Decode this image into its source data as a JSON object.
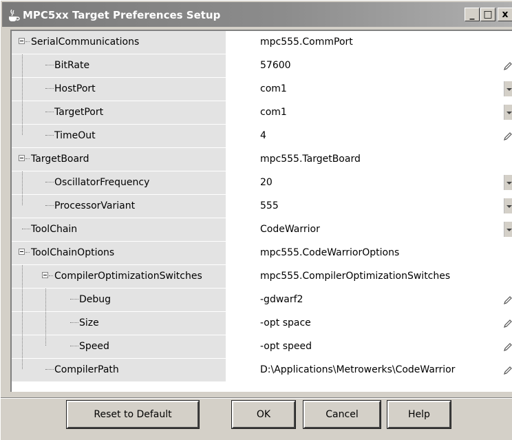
{
  "window": {
    "title": "MPC5xx Target Preferences Setup",
    "minimize_glyph": "_",
    "maximize_glyph": "□",
    "close_glyph": "x"
  },
  "rows": [
    {
      "name": "SerialCommunications",
      "value": "mpc555.CommPort",
      "editor": "none"
    },
    {
      "name": "BitRate",
      "value": "57600",
      "editor": "edit"
    },
    {
      "name": "HostPort",
      "value": "com1",
      "editor": "dropdown"
    },
    {
      "name": "TargetPort",
      "value": "com1",
      "editor": "dropdown"
    },
    {
      "name": "TimeOut",
      "value": "4",
      "editor": "edit"
    },
    {
      "name": "TargetBoard",
      "value": "mpc555.TargetBoard",
      "editor": "none"
    },
    {
      "name": "OscillatorFrequency",
      "value": "20",
      "editor": "dropdown"
    },
    {
      "name": "ProcessorVariant",
      "value": "555",
      "editor": "dropdown"
    },
    {
      "name": "ToolChain",
      "value": "CodeWarrior",
      "editor": "dropdown"
    },
    {
      "name": "ToolChainOptions",
      "value": "mpc555.CodeWarriorOptions",
      "editor": "none"
    },
    {
      "name": "CompilerOptimizationSwitches",
      "value": "mpc555.CompilerOptimizationSwitches",
      "editor": "none"
    },
    {
      "name": "Debug",
      "value": "-gdwarf2",
      "editor": "edit"
    },
    {
      "name": "Size",
      "value": "-opt space",
      "editor": "edit"
    },
    {
      "name": "Speed",
      "value": "-opt speed",
      "editor": "edit"
    },
    {
      "name": "CompilerPath",
      "value": "D:\\Applications\\Metrowerks\\CodeWarrior",
      "editor": "edit"
    }
  ],
  "buttons": {
    "reset": "Reset to Default",
    "ok": "OK",
    "cancel": "Cancel",
    "help": "Help"
  },
  "colors": {
    "name_cell_bg": "#e3e3e3",
    "dialog_bg": "#d4d0c8",
    "title_bar": "#8c8c8c"
  }
}
